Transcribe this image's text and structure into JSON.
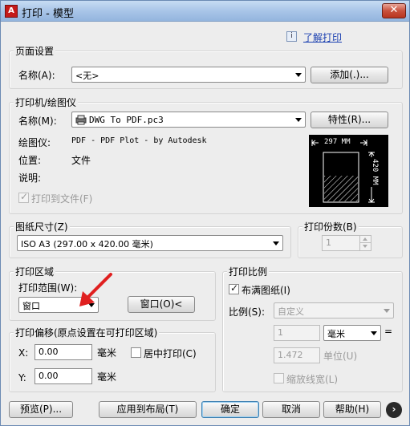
{
  "window": {
    "title": "打印 - 模型",
    "close": "✕",
    "help_link": "了解打印"
  },
  "page_setup": {
    "group_title": "页面设置",
    "name_label": "名称(A):",
    "name_value": "<无>",
    "add_button": "添加(.)..."
  },
  "printer": {
    "group_title": "打印机/绘图仪",
    "name_label": "名称(M):",
    "name_value": "DWG To PDF.pc3",
    "properties_button": "特性(R)...",
    "plotter_label": "绘图仪:",
    "plotter_value": "PDF - PDF Plot - by Autodesk",
    "location_label": "位置:",
    "location_value": "文件",
    "description_label": "说明:",
    "plot_to_file_label": "打印到文件(F)",
    "plot_to_file_checked": true,
    "preview_width": "297 MM",
    "preview_height": "420 MM"
  },
  "paper_size": {
    "group_title": "图纸尺寸(Z)",
    "value": "ISO A3 (297.00 x 420.00 毫米)"
  },
  "copies": {
    "group_title": "打印份数(B)",
    "value": "1"
  },
  "plot_area": {
    "group_title": "打印区域",
    "what_label": "打印范围(W):",
    "what_value": "窗口",
    "window_button": "窗口(O)<"
  },
  "plot_offset": {
    "group_title": "打印偏移(原点设置在可打印区域)",
    "x_label": "X:",
    "x_value": "0.00",
    "y_label": "Y:",
    "y_value": "0.00",
    "unit": "毫米",
    "center_label": "居中打印(C)",
    "center_checked": false
  },
  "plot_scale": {
    "group_title": "打印比例",
    "fit_label": "布满图纸(I)",
    "fit_checked": true,
    "scale_label": "比例(S):",
    "scale_value": "自定义",
    "value1": "1",
    "unit_value": "毫米",
    "equals": "=",
    "value2": "1.472",
    "unit2_label": "单位(U)",
    "lineweights_label": "缩放线宽(L)",
    "lineweights_checked": false
  },
  "footer": {
    "preview_button": "预览(P)...",
    "apply_button": "应用到布局(T)",
    "ok_button": "确定",
    "cancel_button": "取消",
    "help_button": "帮助(H)",
    "more_button": "›"
  },
  "colors": {
    "accent": "#1a3fb0",
    "close_red": "#c9513d",
    "arrow_red": "#e02020"
  }
}
